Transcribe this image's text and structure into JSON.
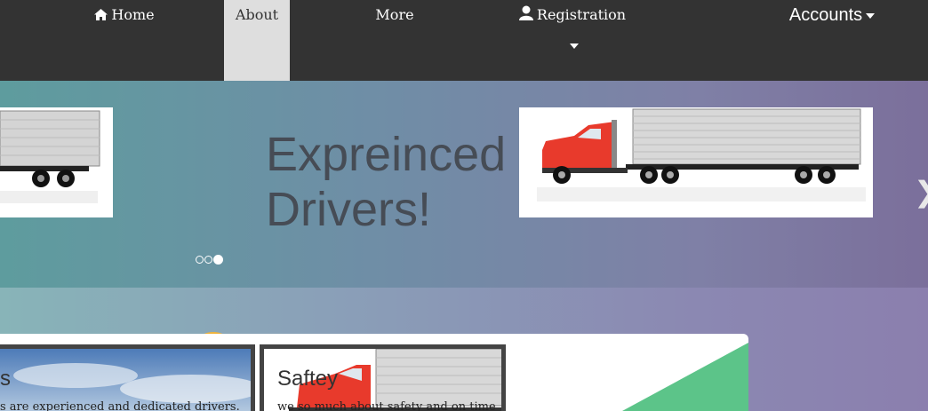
{
  "nav": {
    "items": [
      {
        "label": "Home",
        "icon": "home-icon"
      },
      {
        "label": "About",
        "active": true
      },
      {
        "label": "More"
      },
      {
        "label": "Registration",
        "icon": "user-icon",
        "dropdown": true
      },
      {
        "label": "Accounts",
        "dropdown": true
      }
    ]
  },
  "hero": {
    "title_line1": "Expreinced",
    "title_line2": "Drivers!",
    "slide_count": 3,
    "active_slide": 3
  },
  "cards": [
    {
      "title": "s",
      "text": "s are experienced and dedicated drivers."
    },
    {
      "title": "Saftey",
      "text": "we so much about safety and on time"
    }
  ],
  "colors": {
    "nav_bg": "#333333",
    "nav_active": "#dedede",
    "truck_cab": "#e83a2c",
    "accent_green": "#5cc489"
  }
}
